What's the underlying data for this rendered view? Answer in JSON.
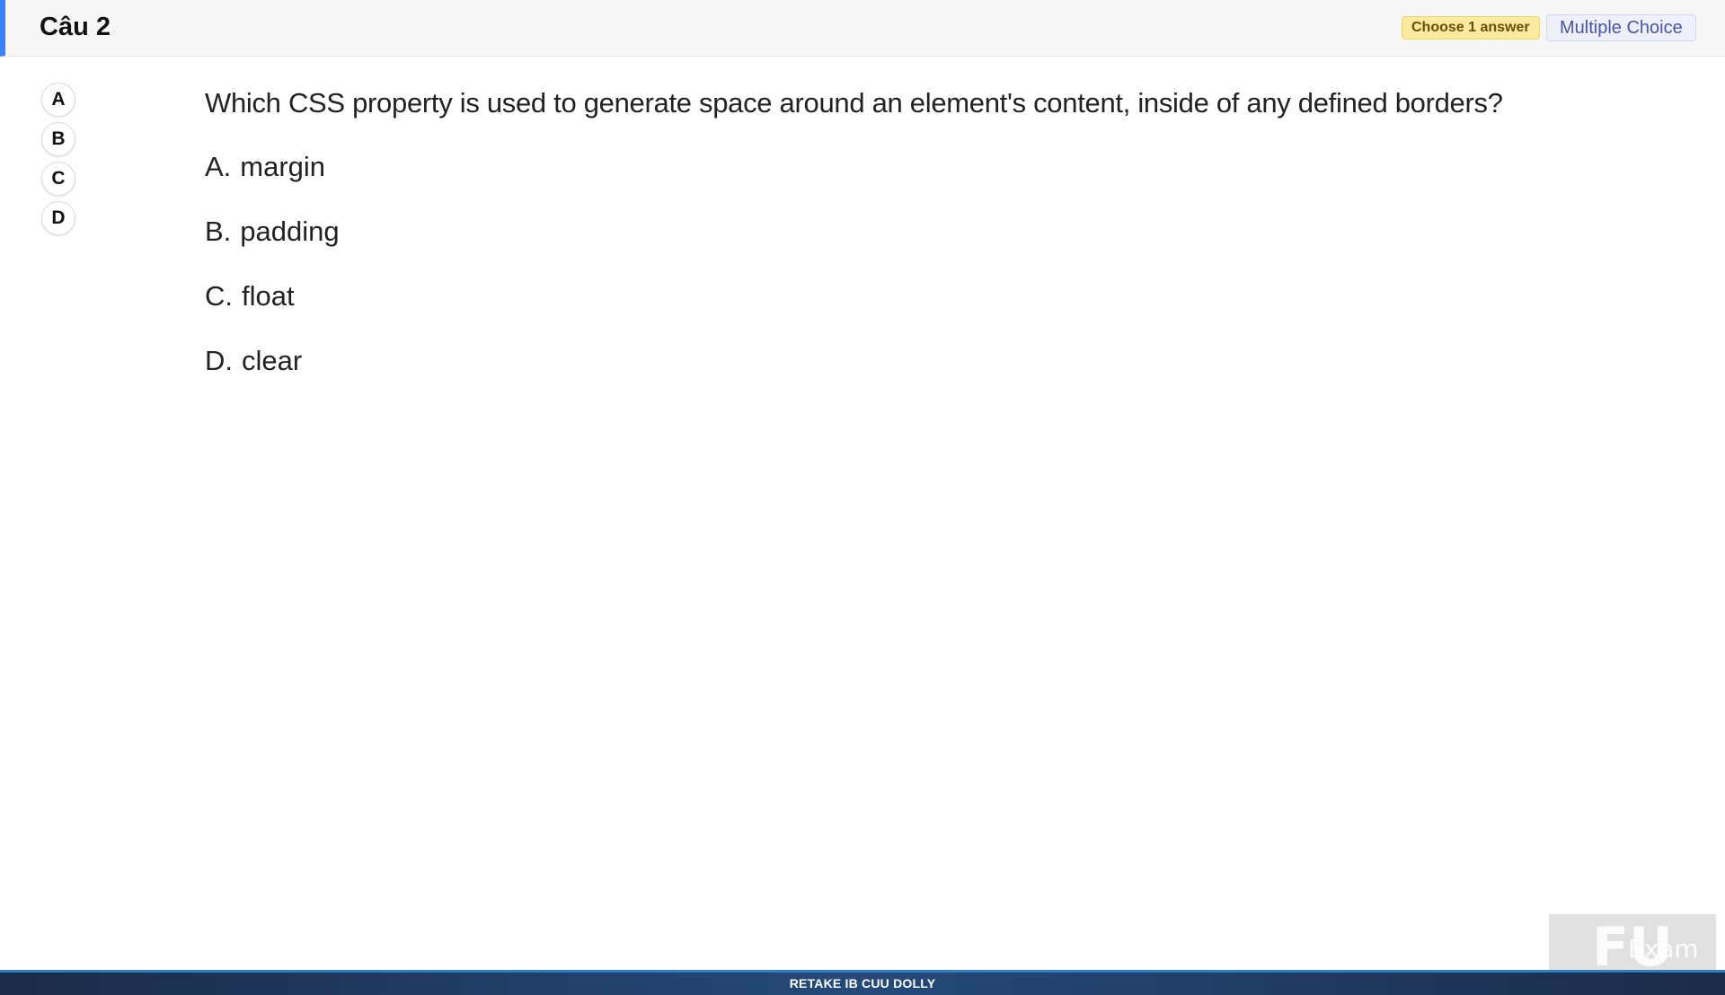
{
  "header": {
    "title": "Câu 2",
    "answer_badge": "Choose 1 answer",
    "type_badge": "Multiple Choice"
  },
  "answer_bubbles": [
    "A",
    "B",
    "C",
    "D"
  ],
  "question": {
    "text": "Which CSS property is used to generate space around an element's content, inside of any defined borders?",
    "options": [
      {
        "letter": "A.",
        "text": "margin"
      },
      {
        "letter": "B.",
        "text": "padding"
      },
      {
        "letter": "C.",
        "text": "float"
      },
      {
        "letter": "D.",
        "text": "clear"
      }
    ]
  },
  "footer": {
    "text": "RETAKE IB CUU DOLLY"
  },
  "logo": {
    "mark": "FU",
    "word": "Exam"
  },
  "colors": {
    "accent": "#3b82f6",
    "badge_choose_bg": "#fdeaa0",
    "badge_type_text": "#4a55a8",
    "footer_bg": "#1b2b48"
  }
}
